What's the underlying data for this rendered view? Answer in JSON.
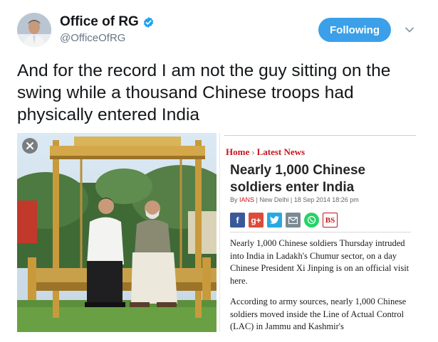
{
  "tweet": {
    "author": {
      "display_name": "Office of RG",
      "handle": "@OfficeOfRG",
      "verified_icon": "verified-badge-icon"
    },
    "follow_button_label": "Following",
    "text": "And for the record I am not the guy sitting on the swing while a thousand Chinese troops had physically entered India"
  },
  "media": {
    "close_icon": "close-icon",
    "article": {
      "breadcrumb": [
        "Home",
        "Latest News"
      ],
      "breadcrumb_separator": "›",
      "headline": "Nearly 1,000 Chinese soldiers enter India",
      "byline_prefix": "By ",
      "byline_author": "IANS",
      "byline_rest": " | New Delhi | 18 Sep 2014 18:26 pm",
      "share_buttons": [
        {
          "label": "f",
          "icon": "facebook-icon"
        },
        {
          "label": "g+",
          "icon": "google-plus-icon"
        },
        {
          "label": "t",
          "icon": "twitter-icon"
        },
        {
          "label": "",
          "icon": "email-icon"
        },
        {
          "label": "",
          "icon": "whatsapp-icon"
        },
        {
          "label": "BS",
          "icon": "business-standard-icon"
        }
      ],
      "paragraph_1": "Nearly 1,000 Chinese soldiers Thursday intruded into India in Ladakh's Chumur sector, on a day Chinese President Xi Jinping is on an official visit here.",
      "paragraph_2": "According to army sources, nearly 1,000 Chinese soldiers moved inside the Line of Actual Control (LAC) in Jammu and Kashmir's"
    }
  },
  "colors": {
    "follow_button": "#3ba0e9",
    "verified": "#1da1f2",
    "article_red": "#c4161c",
    "text": "#14171a",
    "handle": "#657786"
  }
}
